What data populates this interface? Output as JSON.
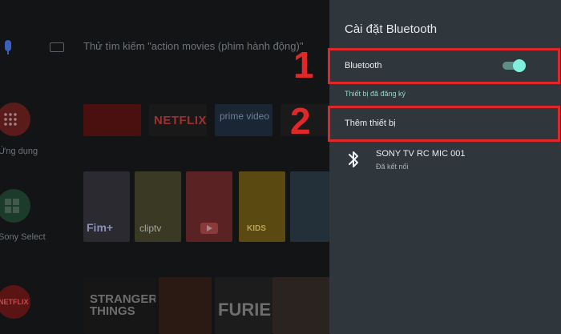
{
  "home": {
    "search_hint": "Thử tìm kiếm \"action movies (phim hành động)\"",
    "apps_label": "Ứng dụng",
    "select_label": "Sony Select",
    "tiles": {
      "netflix": "NETFLIX",
      "prime": "prime video",
      "fim": "Fim+",
      "clip": "cliptv",
      "kids": "KIDS",
      "stranger": "STRANGER THINGS",
      "furie": "FURIE",
      "netflix_app": "NETFLIX"
    }
  },
  "panel": {
    "title": "Cài đặt Bluetooth",
    "bluetooth_label": "Bluetooth",
    "bluetooth_enabled": true,
    "paired_section": "Thiết bị đã đăng ký",
    "add_device_label": "Thêm thiết bị",
    "device": {
      "name": "SONY TV RC MIC 001",
      "status": "Đã kết nối",
      "icon": "bluetooth-icon"
    }
  },
  "annotations": {
    "step1": "1",
    "step2": "2",
    "color": "#e0272a"
  },
  "colors": {
    "panel_bg": "#2f363c",
    "toggle_on": "#7ff0de",
    "section_accent": "#8fd9cc"
  }
}
